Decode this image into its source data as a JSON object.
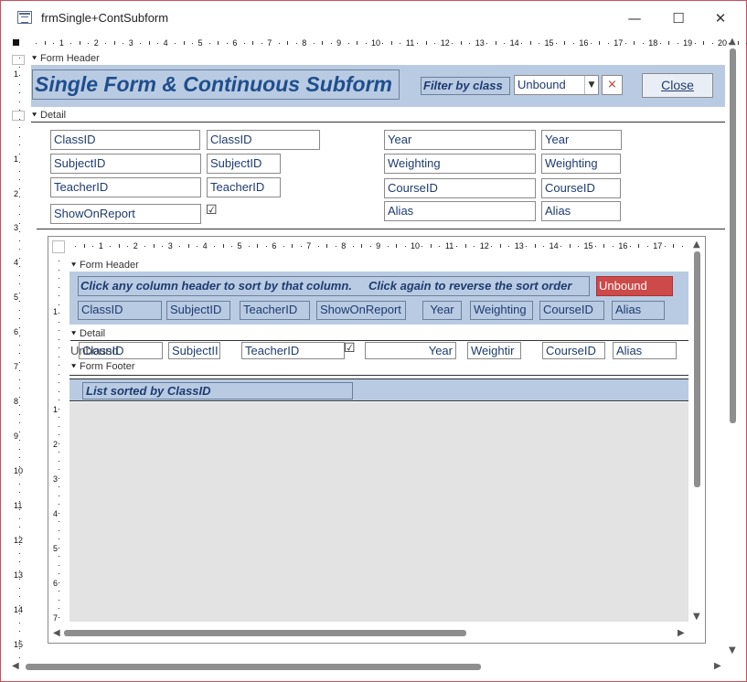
{
  "window": {
    "title": "frmSingle+ContSubform",
    "minimize": "—",
    "maximize": "☐",
    "close": "✕"
  },
  "form": {
    "sections": {
      "form_header": "Form Header",
      "detail": "Detail"
    },
    "header": {
      "title": "Single Form & Continuous Subform",
      "filter_label": "Filter by class",
      "filter_value": "Unbound",
      "close_button": "Close"
    },
    "detail_fields": {
      "left": [
        {
          "label": "ClassID",
          "field": "ClassID"
        },
        {
          "label": "SubjectID",
          "field": "SubjectID"
        },
        {
          "label": "TeacherID",
          "field": "TeacherID"
        },
        {
          "label": "ShowOnReport",
          "field": "☑"
        }
      ],
      "right": [
        {
          "label": "Year",
          "field": "Year"
        },
        {
          "label": "Weighting",
          "field": "Weighting"
        },
        {
          "label": "CourseID",
          "field": "CourseID"
        },
        {
          "label": "Alias",
          "field": "Alias"
        }
      ]
    }
  },
  "subform": {
    "sections": {
      "form_header": "Form Header",
      "detail": "Detail",
      "form_footer": "Form Footer"
    },
    "header": {
      "instruction": "Click any column header to sort by that column.     Click again to reverse the sort order",
      "unbound": "Unbound",
      "columns": [
        "ClassID",
        "SubjectID",
        "TeacherID",
        "ShowOnReport",
        "Year",
        "Weighting",
        "CourseID",
        "Alias"
      ]
    },
    "detail": {
      "overlap_text": "Unbound",
      "fields": [
        "ClassID",
        "SubjectII",
        "TeacherID",
        "☑",
        "Year",
        "Weightir",
        "CourseID",
        "Alias"
      ]
    },
    "footer": {
      "sort_label": "List sorted by ClassID"
    }
  },
  "rulers": {
    "main_h": [
      "1",
      "2",
      "3",
      "4",
      "5",
      "6",
      "7",
      "8",
      "9",
      "10",
      "11",
      "12",
      "13",
      "14",
      "15",
      "16",
      "17",
      "18",
      "19",
      "20"
    ],
    "main_v": [
      "1",
      "1",
      "2",
      "3",
      "4",
      "5",
      "6",
      "7",
      "8",
      "9",
      "10",
      "11",
      "12",
      "13",
      "14",
      "15"
    ],
    "sub_h": [
      "1",
      "2",
      "3",
      "4",
      "5",
      "6",
      "7",
      "8",
      "9",
      "10",
      "11",
      "12",
      "13",
      "14",
      "15",
      "16",
      "17"
    ],
    "sub_v": [
      "1",
      "1",
      "2",
      "3",
      "4",
      "5",
      "6",
      "7"
    ]
  },
  "colors": {
    "accent_header": "#b9cbe3",
    "text_blue": "#1f3b6f",
    "unbound_red": "#cc4a4a",
    "window_border": "#c8515a"
  },
  "icons": {
    "filter_clear": "filter-clear-icon",
    "dropdown": "chevron-down-icon"
  }
}
